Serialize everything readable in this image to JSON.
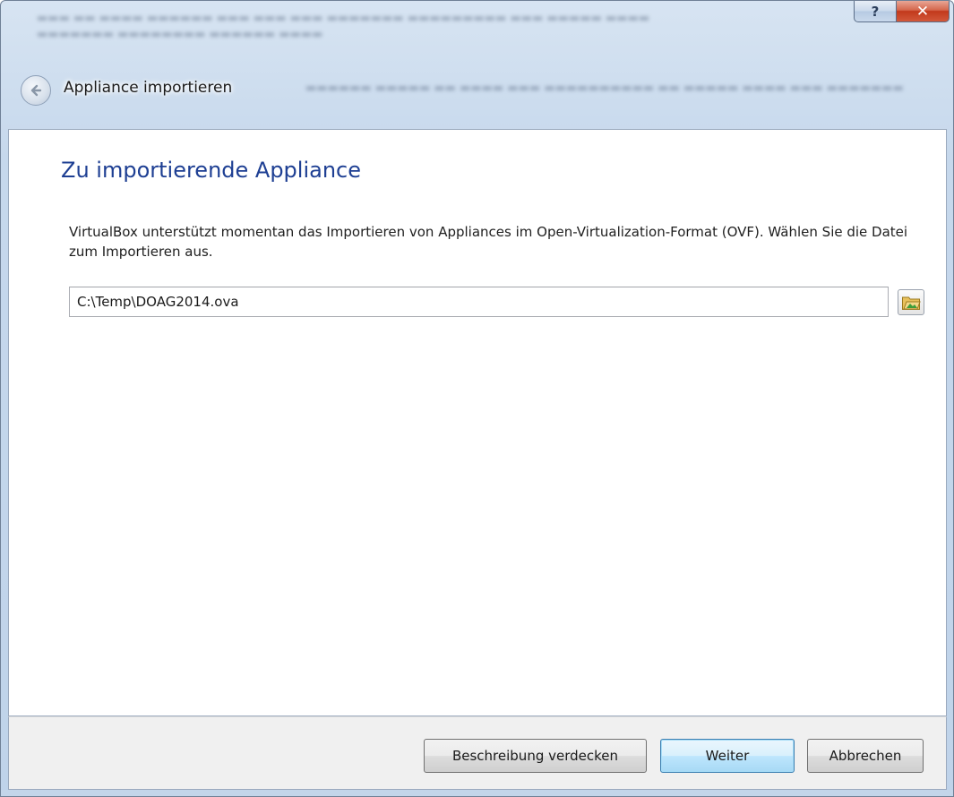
{
  "window": {
    "help_label": "?",
    "close_label": "✕"
  },
  "wizard": {
    "title": "Appliance importieren",
    "back_icon": "back-arrow-icon"
  },
  "page": {
    "heading": "Zu importierende Appliance",
    "description": "VirtualBox unterstützt momentan das Importieren von Appliances im Open-Virtualization-Format (OVF). Wählen Sie die Datei zum Importieren aus.",
    "file_path": "C:\\Temp\\DOAG2014.ova",
    "folder_icon": "folder-open-icon"
  },
  "footer": {
    "describe_label": "Beschreibung verdecken",
    "next_label": "Weiter",
    "cancel_label": "Abbrechen"
  },
  "colors": {
    "heading": "#1e3f93",
    "close_button": "#c2391c",
    "default_button_border": "#3c7fb1"
  }
}
